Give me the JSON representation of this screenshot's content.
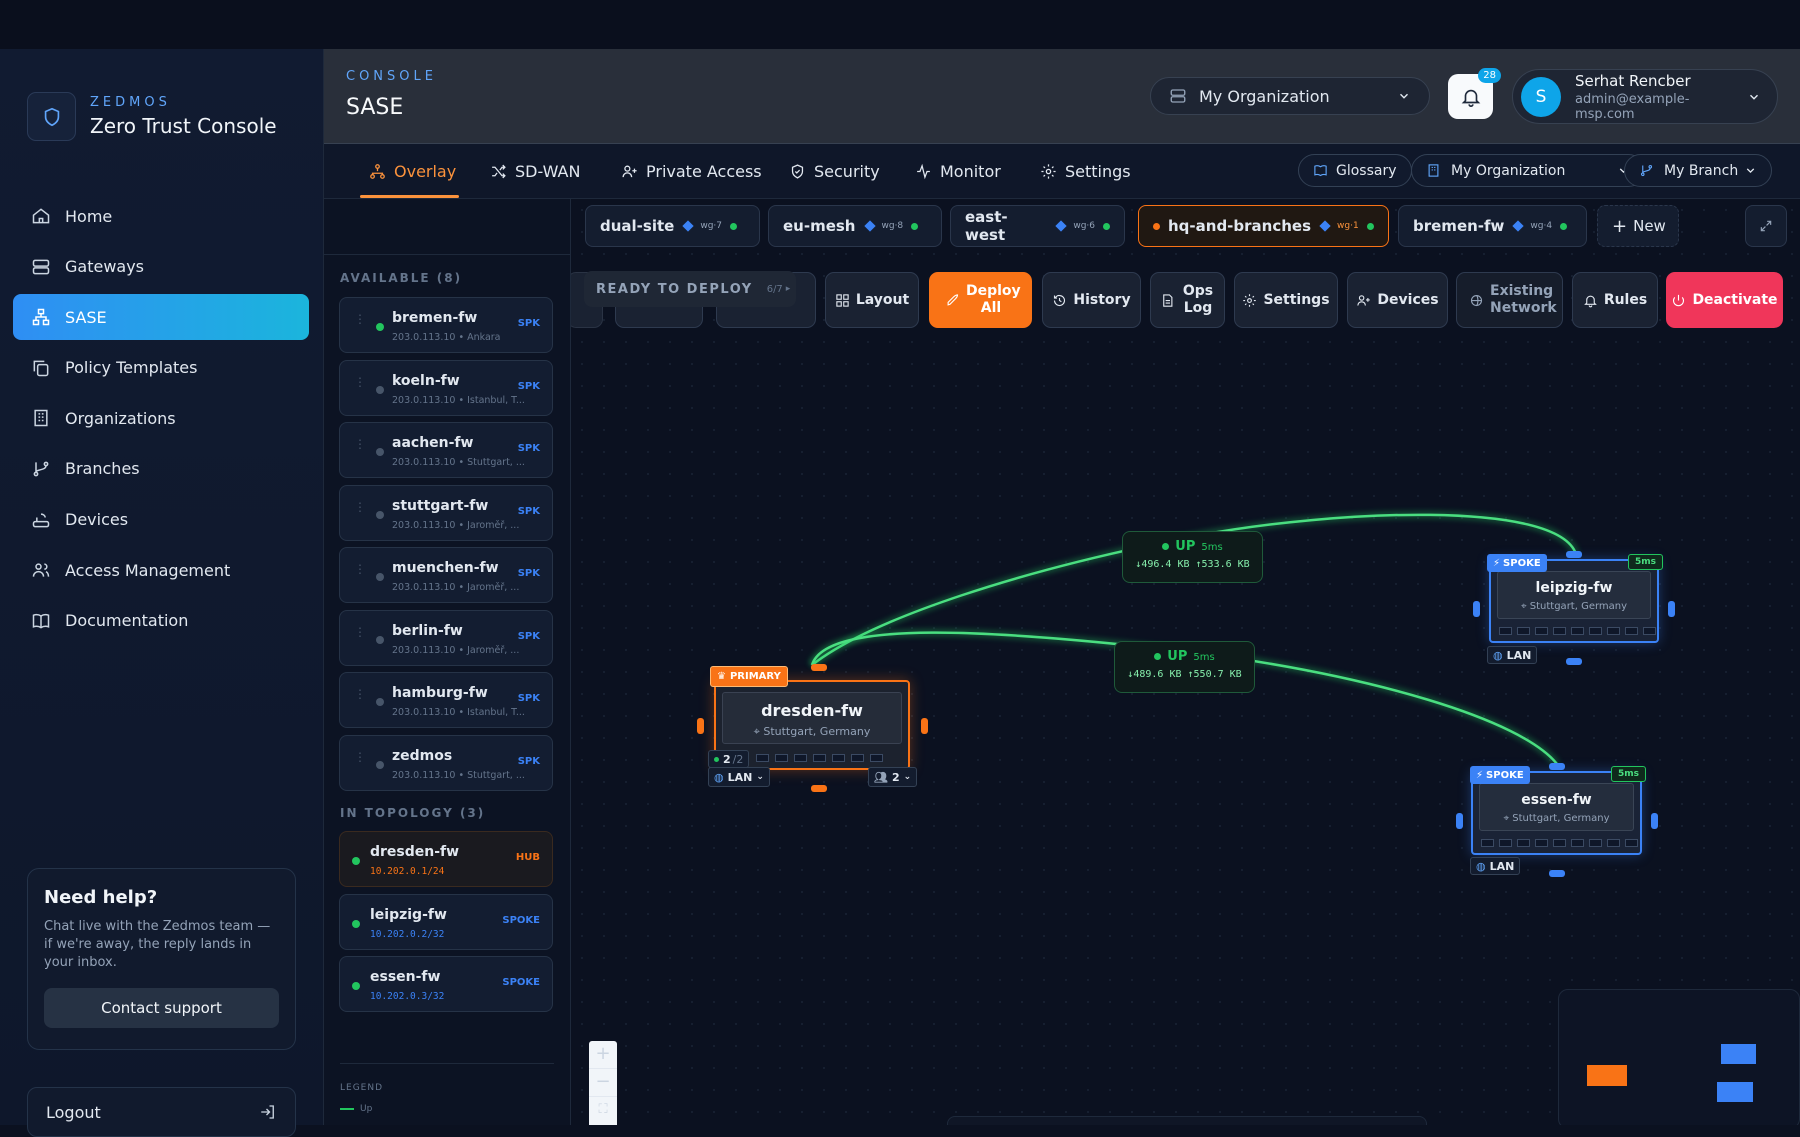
{
  "sidebar": {
    "brand_kicker": "ZEDMOS",
    "brand_title": "Zero Trust Console",
    "items": [
      {
        "label": "Home",
        "icon": "home-icon"
      },
      {
        "label": "Gateways",
        "icon": "server-icon"
      },
      {
        "label": "SASE",
        "icon": "network-icon",
        "active": true
      },
      {
        "label": "Policy Templates",
        "icon": "copy-icon"
      },
      {
        "label": "Organizations",
        "icon": "building-icon"
      },
      {
        "label": "Branches",
        "icon": "git-branch-icon"
      },
      {
        "label": "Devices",
        "icon": "router-icon"
      },
      {
        "label": "Access Management",
        "icon": "users-icon"
      },
      {
        "label": "Documentation",
        "icon": "book-icon"
      }
    ],
    "help": {
      "title": "Need help?",
      "body": "Chat live with the Zedmos team — if we're away, the reply lands in your inbox.",
      "button": "Contact support"
    },
    "logout": "Logout"
  },
  "header": {
    "kicker": "CONSOLE",
    "title": "SASE",
    "org_select": "My Organization",
    "notifications": "28",
    "user": {
      "initial": "S",
      "name": "Serhat Rencber",
      "email": "admin@example-msp.com"
    }
  },
  "tabs": [
    {
      "label": "Overlay",
      "icon": "topology-icon",
      "active": true
    },
    {
      "label": "SD-WAN",
      "icon": "shuffle-icon"
    },
    {
      "label": "Private Access",
      "icon": "user-plus-icon"
    },
    {
      "label": "Security",
      "icon": "shield-check-icon"
    },
    {
      "label": "Monitor",
      "icon": "activity-icon"
    },
    {
      "label": "Settings",
      "icon": "gear-icon"
    }
  ],
  "tab_actions": {
    "glossary": "Glossary",
    "org": "My Organization",
    "branch": "My Branch"
  },
  "panel": {
    "available_label": "AVAILABLE (8)",
    "available": [
      {
        "name": "bremen-fw",
        "sub": "203.0.113.10 • Ankara",
        "tag": "SPK",
        "online": true
      },
      {
        "name": "koeln-fw",
        "sub": "203.0.113.10 • Istanbul, T...",
        "tag": "SPK",
        "online": false
      },
      {
        "name": "aachen-fw",
        "sub": "203.0.113.10 • Stuttgart, ...",
        "tag": "SPK",
        "online": false
      },
      {
        "name": "stuttgart-fw",
        "sub": "203.0.113.10 • Jaroměř, ...",
        "tag": "SPK",
        "online": false
      },
      {
        "name": "muenchen-fw",
        "sub": "203.0.113.10 • Jaroměř, ...",
        "tag": "SPK",
        "online": false
      },
      {
        "name": "berlin-fw",
        "sub": "203.0.113.10 • Jaroměř, ...",
        "tag": "SPK",
        "online": false
      },
      {
        "name": "hamburg-fw",
        "sub": "203.0.113.10 • Istanbul, T...",
        "tag": "SPK",
        "online": false
      },
      {
        "name": "zedmos",
        "sub": "203.0.113.10 • Stuttgart, ...",
        "tag": "SPK",
        "online": false
      }
    ],
    "topology_label": "IN TOPOLOGY (3)",
    "topology": [
      {
        "name": "dresden-fw",
        "sub": "10.202.0.1/24",
        "tag": "HUB"
      },
      {
        "name": "leipzig-fw",
        "sub": "10.202.0.2/32",
        "tag": "SPOKE"
      },
      {
        "name": "essen-fw",
        "sub": "10.202.0.3/32",
        "tag": "SPOKE"
      }
    ],
    "legend_label": "LEGEND",
    "legend_up": "Up"
  },
  "overlays": [
    {
      "name": "dual-site",
      "wg": "wg·7"
    },
    {
      "name": "eu-mesh",
      "wg": "wg·8"
    },
    {
      "name": "east-west",
      "wg": "wg·6"
    },
    {
      "name": "hq-and-branches",
      "wg": "wg·1",
      "active": true
    },
    {
      "name": "bremen-fw",
      "wg": "wg·4"
    }
  ],
  "new_overlay": "New",
  "toolbar": {
    "ready": "READY TO DEPLOY",
    "ready_count": "6/7",
    "layout": "Layout",
    "deploy": "Deploy All",
    "history": "History",
    "ops_log": "Ops Log",
    "settings": "Settings",
    "devices": "Devices",
    "existing": "Existing Network",
    "rules": "Rules",
    "deactivate": "Deactivate"
  },
  "links": [
    {
      "status": "UP",
      "latency": "5ms",
      "bytes": "↓496.4 KB ↑533.6 KB"
    },
    {
      "status": "UP",
      "latency": "5ms",
      "bytes": "↓489.6 KB ↑550.7 KB"
    }
  ],
  "nodes": {
    "hub": {
      "badge": "PRIMARY",
      "name": "dresden-fw",
      "loc": "Stuttgart, Germany",
      "peers": "2",
      "peers_total": "/2",
      "lan": "LAN",
      "users": "2"
    },
    "spoke1": {
      "badge": "SPOKE",
      "latency": "5ms",
      "name": "leipzig-fw",
      "loc": "Stuttgart, Germany",
      "lan": "LAN"
    },
    "spoke2": {
      "badge": "SPOKE",
      "latency": "5ms",
      "name": "essen-fw",
      "loc": "Stuttgart, Germany",
      "lan": "LAN"
    }
  },
  "colors": {
    "accent": "#f97316",
    "active_nav": "#2f8ef4",
    "up": "#22c55e",
    "spoke": "#3b82f6",
    "danger": "#f0365a"
  }
}
